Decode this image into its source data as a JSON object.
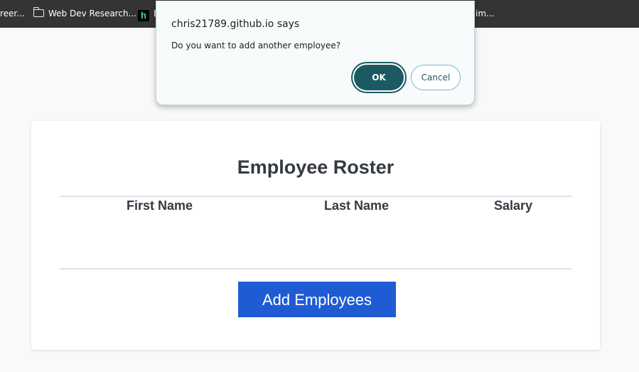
{
  "bookmarks": {
    "items": [
      {
        "label": "reer...",
        "icon": null
      },
      {
        "label": "Web Dev Research...",
        "icon": "folder-icon"
      },
      {
        "label": "E",
        "icon": "h-icon",
        "icon_glyph": "h"
      },
      {
        "label": "im...",
        "icon": null
      }
    ]
  },
  "card": {
    "title": "Employee Roster",
    "columns": [
      "First Name",
      "Last Name",
      "Salary"
    ],
    "add_button_label": "Add Employees"
  },
  "dialog": {
    "title": "chris21789.github.io says",
    "message": "Do you want to add another employee?",
    "ok_label": "OK",
    "cancel_label": "Cancel"
  },
  "colors": {
    "bookmarks_bar": "#343434",
    "primary_button": "#1f5cd4",
    "dialog_accent": "#1c5a63",
    "page_background": "#f8f9fa"
  }
}
